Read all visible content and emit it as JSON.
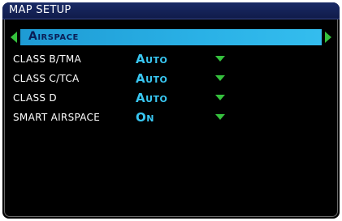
{
  "window": {
    "title": "MAP SETUP"
  },
  "selector": {
    "label": "Airspace",
    "left_arrow_icon": "arrow-left-icon",
    "right_arrow_icon": "arrow-right-icon"
  },
  "settings": [
    {
      "label": "CLASS B/TMA",
      "value": "Auto"
    },
    {
      "label": "CLASS C/TCA",
      "value": "Auto"
    },
    {
      "label": "CLASS D",
      "value": "Auto"
    },
    {
      "label": "SMART AIRSPACE",
      "value": "On"
    }
  ],
  "colors": {
    "title_bar": "#1a2b66",
    "selector_bar": "#2ab1e6",
    "value_text": "#39c7f2",
    "arrow_green": "#35c13d"
  }
}
